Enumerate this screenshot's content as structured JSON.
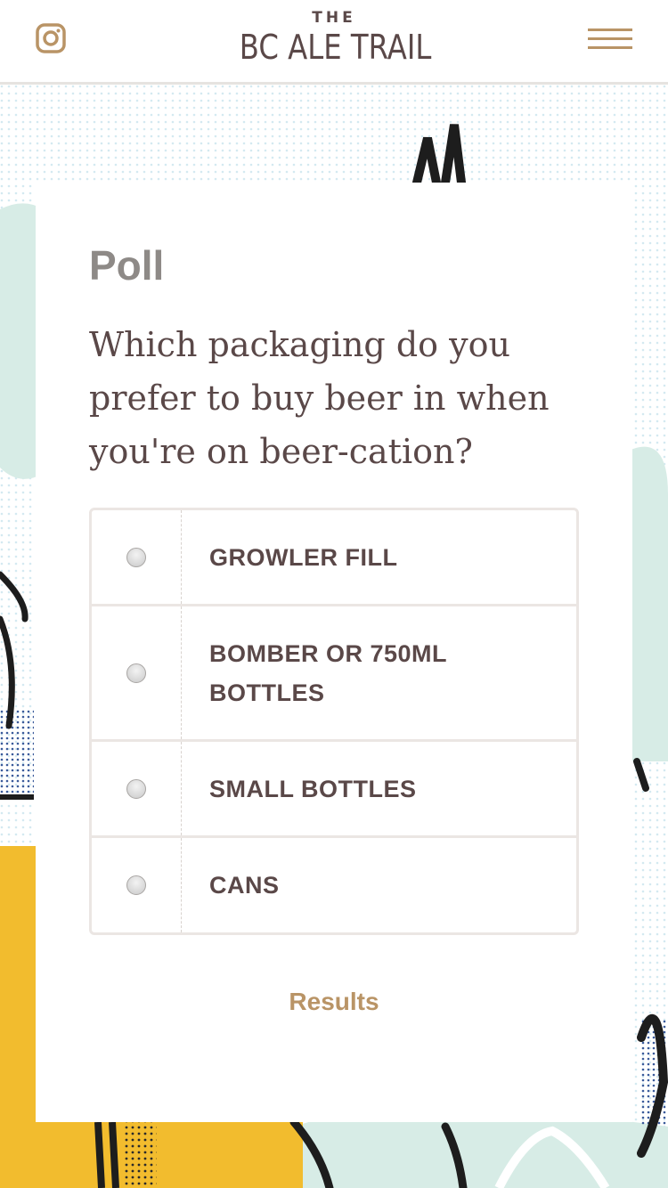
{
  "header": {
    "logo_the": "THE",
    "logo_main": "BC ALE TRAIL",
    "instagram_icon": "instagram-icon",
    "menu_icon": "hamburger-menu-icon"
  },
  "poll": {
    "heading": "Poll",
    "question": "Which packaging do you prefer to buy beer in when you're on beer-cation?",
    "options": [
      {
        "label": "GROWLER FILL"
      },
      {
        "label": "BOMBER OR 750ML BOTTLES"
      },
      {
        "label": "SMALL BOTTLES"
      },
      {
        "label": "CANS"
      }
    ],
    "results_label": "Results"
  },
  "colors": {
    "accent": "#b99466",
    "text_dark": "#5a4848",
    "heading_gray": "#8e8a87",
    "background_yellow": "#f2bc2e",
    "background_mint": "#d7ece6"
  }
}
